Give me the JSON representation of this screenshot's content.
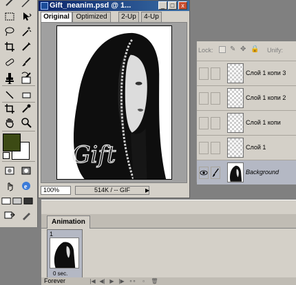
{
  "document": {
    "title": "Gift_neanim.psd @ 1...",
    "tabs": [
      "Original",
      "Optimized",
      "2-Up",
      "4-Up"
    ],
    "active_tab": "Original",
    "zoom": "100%",
    "file_info": "514K / -- GIF",
    "image_text": "Gift",
    "window_buttons": {
      "minimize": "_",
      "maximize": "□",
      "close": "x"
    }
  },
  "layers": {
    "lock_label": "Lock:",
    "unify_label": "Unify:",
    "items": [
      {
        "name": "Слой 1 копи 3",
        "visible": false,
        "selected": false
      },
      {
        "name": "Слой 1 копи 2",
        "visible": false,
        "selected": false
      },
      {
        "name": "Слой 1 копи",
        "visible": false,
        "selected": false
      },
      {
        "name": "Слой 1",
        "visible": false,
        "selected": false
      },
      {
        "name": "Background",
        "visible": true,
        "selected": true
      }
    ]
  },
  "animation": {
    "tab_label": "Animation",
    "frames": [
      {
        "number": "1",
        "delay": "0 sec."
      }
    ],
    "loop": "Forever"
  },
  "colors": {
    "foreground": "#3c4a14",
    "background": "#ffffff",
    "titlebar": "#0a246a",
    "selected_layer": "#b4b8c4"
  },
  "tools": [
    "marquee-tool",
    "move-tool",
    "lasso-tool",
    "magic-wand-tool",
    "crop-tool",
    "slice-tool",
    "healing-brush-tool",
    "brush-tool",
    "clone-stamp-tool",
    "history-brush-tool",
    "eraser-tool",
    "gradient-tool",
    "blur-tool",
    "dodge-tool",
    "path-selection-tool",
    "type-tool",
    "pen-tool",
    "shape-tool",
    "notes-tool",
    "eyedropper-tool",
    "hand-tool",
    "zoom-tool"
  ]
}
